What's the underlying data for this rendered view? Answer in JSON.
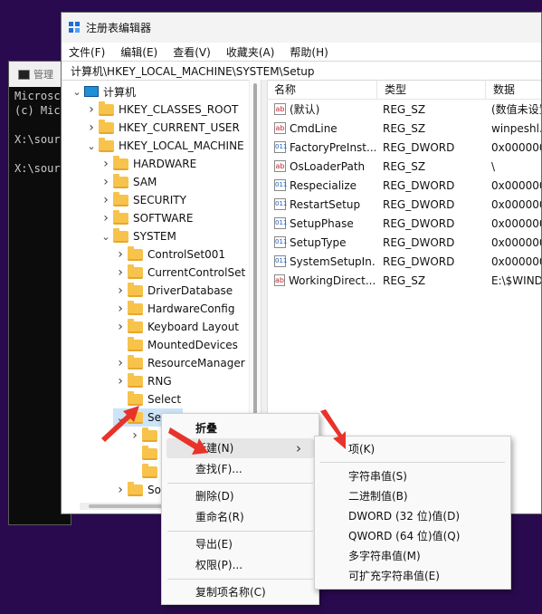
{
  "cmd": {
    "title": "管理",
    "lines": [
      "Microsc",
      "(c) Mic",
      "",
      "X:\\sour",
      "",
      "X:\\sour"
    ]
  },
  "window": {
    "title": "注册表编辑器"
  },
  "menu": [
    "文件(F)",
    "编辑(E)",
    "查看(V)",
    "收藏夹(A)",
    "帮助(H)"
  ],
  "address": "计算机\\HKEY_LOCAL_MACHINE\\SYSTEM\\Setup",
  "tree": [
    {
      "label": "计算机",
      "depth": 0,
      "chev": "expanded",
      "icon": "monitor-icon"
    },
    {
      "label": "HKEY_CLASSES_ROOT",
      "depth": 1,
      "chev": "collapsed"
    },
    {
      "label": "HKEY_CURRENT_USER",
      "depth": 1,
      "chev": "collapsed"
    },
    {
      "label": "HKEY_LOCAL_MACHINE",
      "depth": 1,
      "chev": "expanded"
    },
    {
      "label": "HARDWARE",
      "depth": 2,
      "chev": "collapsed"
    },
    {
      "label": "SAM",
      "depth": 2,
      "chev": "collapsed"
    },
    {
      "label": "SECURITY",
      "depth": 2,
      "chev": "collapsed"
    },
    {
      "label": "SOFTWARE",
      "depth": 2,
      "chev": "collapsed"
    },
    {
      "label": "SYSTEM",
      "depth": 2,
      "chev": "expanded"
    },
    {
      "label": "ControlSet001",
      "depth": 3,
      "chev": "collapsed"
    },
    {
      "label": "CurrentControlSet",
      "depth": 3,
      "chev": "collapsed"
    },
    {
      "label": "DriverDatabase",
      "depth": 3,
      "chev": "collapsed"
    },
    {
      "label": "HardwareConfig",
      "depth": 3,
      "chev": "collapsed"
    },
    {
      "label": "Keyboard Layout",
      "depth": 3,
      "chev": "collapsed"
    },
    {
      "label": "MountedDevices",
      "depth": 3,
      "chev": "none"
    },
    {
      "label": "ResourceManager",
      "depth": 3,
      "chev": "collapsed"
    },
    {
      "label": "RNG",
      "depth": 3,
      "chev": "collapsed"
    },
    {
      "label": "Select",
      "depth": 3,
      "chev": "none"
    },
    {
      "label": "Setup",
      "depth": 3,
      "chev": "expanded",
      "selected": true
    },
    {
      "label": "",
      "depth": 4,
      "chev": "collapsed"
    },
    {
      "label": "",
      "depth": 4,
      "chev": "none"
    },
    {
      "label": "",
      "depth": 4,
      "chev": "none"
    },
    {
      "label": "So",
      "depth": 3,
      "chev": "collapsed"
    }
  ],
  "columns": [
    "名称",
    "类型",
    "数据"
  ],
  "values": [
    {
      "icon": "sz",
      "name": "(默认)",
      "type": "REG_SZ",
      "data": "(数值未设置"
    },
    {
      "icon": "sz",
      "name": "CmdLine",
      "type": "REG_SZ",
      "data": "winpeshl.e"
    },
    {
      "icon": "bin",
      "name": "FactoryPreInst...",
      "type": "REG_DWORD",
      "data": "0x0000000"
    },
    {
      "icon": "sz",
      "name": "OsLoaderPath",
      "type": "REG_SZ",
      "data": "\\"
    },
    {
      "icon": "bin",
      "name": "Respecialize",
      "type": "REG_DWORD",
      "data": "0x0000000"
    },
    {
      "icon": "bin",
      "name": "RestartSetup",
      "type": "REG_DWORD",
      "data": "0x0000000"
    },
    {
      "icon": "bin",
      "name": "SetupPhase",
      "type": "REG_DWORD",
      "data": "0x0000000"
    },
    {
      "icon": "bin",
      "name": "SetupType",
      "type": "REG_DWORD",
      "data": "0x0000000"
    },
    {
      "icon": "bin",
      "name": "SystemSetupIn...",
      "type": "REG_DWORD",
      "data": "0x0000000"
    },
    {
      "icon": "sz",
      "name": "WorkingDirect...",
      "type": "REG_SZ",
      "data": "E:\\$WIND"
    }
  ],
  "context_menu": {
    "items": [
      {
        "label": "折叠",
        "bold": true
      },
      {
        "label": "新建(N)",
        "submenu": true,
        "hover": true
      },
      {
        "label": "查找(F)..."
      },
      {
        "sep": true
      },
      {
        "label": "删除(D)"
      },
      {
        "label": "重命名(R)"
      },
      {
        "sep": true
      },
      {
        "label": "导出(E)"
      },
      {
        "label": "权限(P)..."
      },
      {
        "sep": true
      },
      {
        "label": "复制项名称(C)"
      }
    ]
  },
  "submenu": {
    "items": [
      {
        "label": "项(K)"
      },
      {
        "sep": true
      },
      {
        "label": "字符串值(S)"
      },
      {
        "label": "二进制值(B)"
      },
      {
        "label": "DWORD (32 位)值(D)"
      },
      {
        "label": "QWORD (64 位)值(Q)"
      },
      {
        "label": "多字符串值(M)"
      },
      {
        "label": "可扩充字符串值(E)"
      }
    ]
  },
  "colors": {
    "accent_arrow": "#e8332b",
    "folder": "#f7c34b",
    "selection": "#cce4f7"
  }
}
